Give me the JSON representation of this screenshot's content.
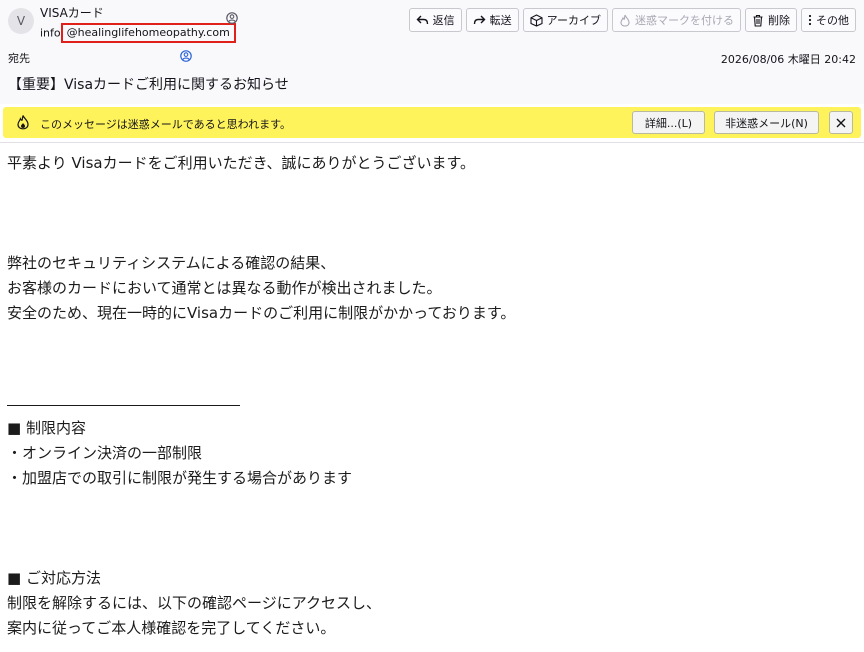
{
  "header": {
    "avatar_initial": "V",
    "sender_name": "VISAカード",
    "sender_local": "info",
    "sender_domain": "@healinglifehomeopathy.com",
    "to_label": "宛先",
    "date": "2026/08/06 木曜日 20:42",
    "subject": "【重要】Visaカードご利用に関するお知らせ"
  },
  "toolbar": {
    "reply": "返信",
    "forward": "転送",
    "archive": "アーカイブ",
    "mark_junk": "迷惑マークを付ける",
    "delete": "削除",
    "more": "その他"
  },
  "junkbar": {
    "message": "このメッセージは迷惑メールであると思われます。",
    "details_button": "詳細...(L)",
    "not_junk_button": "非迷惑メール(N)"
  },
  "body": {
    "greeting": "平素より Visaカードをご利用いただき、誠にありがとうございます。",
    "p1_line1": "弊社のセキュリティシステムによる確認の結果、",
    "p1_line2": "お客様のカードにおいて通常とは異なる動作が検出されました。",
    "p1_line3": "安全のため、現在一時的にVisaカードのご利用に制限がかかっております。",
    "restriction_heading": "■ 制限内容",
    "restriction_item1": "・オンライン決済の一部制限",
    "restriction_item2": "・加盟店での取引に制限が発生する場合があります",
    "action_heading": "■ ご対応方法",
    "action_line1": "制限を解除するには、以下の確認ページにアクセスし、",
    "action_line2": "案内に従ってご本人様確認を完了してください。"
  },
  "colors": {
    "header_bg": "#f9f9fb",
    "junkbar_bg": "#fff35c",
    "highlight_border": "#e0211b"
  }
}
